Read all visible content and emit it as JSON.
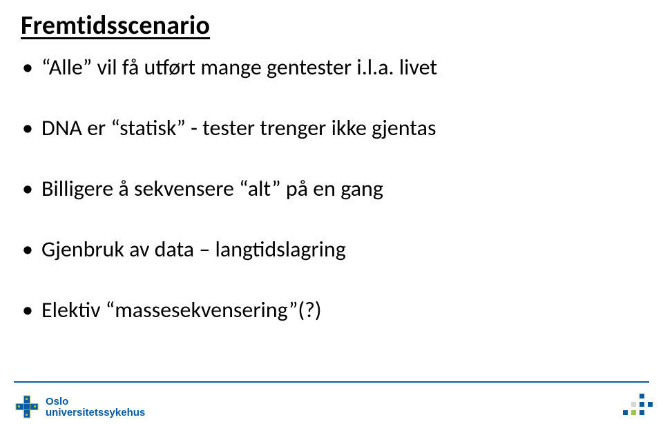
{
  "title": "Fremtidsscenario",
  "bullets": [
    {
      "parts": [
        {
          "kind": "quoted",
          "text": "Alle"
        },
        {
          "kind": "text",
          "text": " vil få utført mange gentester i.l.a. livet"
        }
      ]
    },
    {
      "parts": [
        {
          "kind": "text",
          "text": "DNA er "
        },
        {
          "kind": "quoted",
          "text": "statisk"
        },
        {
          "kind": "text",
          "text": " - tester trenger ikke gjentas"
        }
      ]
    },
    {
      "parts": [
        {
          "kind": "text",
          "text": "Billigere å sekvensere "
        },
        {
          "kind": "quoted",
          "text": "alt"
        },
        {
          "kind": "text",
          "text": " på en gang"
        }
      ]
    },
    {
      "parts": [
        {
          "kind": "text",
          "text": "Gjenbruk av data – langtidslagring"
        }
      ]
    },
    {
      "parts": [
        {
          "kind": "text",
          "text": "Elektiv "
        },
        {
          "kind": "quoted",
          "text": "massesekvensering"
        },
        {
          "kind": "text",
          "text": "(?)"
        }
      ]
    }
  ],
  "logo": {
    "line1": "Oslo",
    "line2": "universitetssykehus"
  }
}
